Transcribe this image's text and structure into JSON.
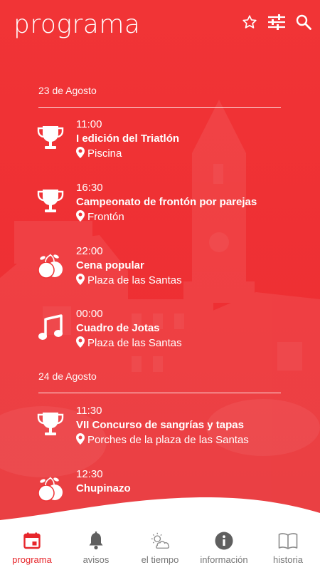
{
  "header": {
    "title": "programa",
    "icons": [
      "star-outline-icon",
      "sliders-icon",
      "search-icon"
    ]
  },
  "colors": {
    "brand_red": "#ef3235",
    "active_nav": "#e7262b",
    "inactive_nav": "#777777"
  },
  "days": [
    {
      "date": "23 de Agosto",
      "events": [
        {
          "time": "11:00",
          "name": "I edición del Triatlón",
          "place": "Piscina",
          "icon": "trophy-icon"
        },
        {
          "time": "16:30",
          "name": "Campeonato de frontón por parejas",
          "place": "Frontón",
          "icon": "trophy-icon"
        },
        {
          "time": "22:00",
          "name": "Cena popular",
          "place": "Plaza de las Santas",
          "icon": "food-icon"
        },
        {
          "time": "00:00",
          "name": "Cuadro de Jotas",
          "place": "Plaza de las Santas",
          "icon": "music-note-icon"
        }
      ]
    },
    {
      "date": "24 de Agosto",
      "events": [
        {
          "time": "11:30",
          "name": "VII Concurso de sangrías y tapas",
          "place": "Porches de la plaza de las Santas",
          "icon": "trophy-icon"
        },
        {
          "time": "12:30",
          "name": "Chupinazo",
          "place": "",
          "icon": "food-icon"
        }
      ]
    }
  ],
  "nav": [
    {
      "label": "programa",
      "icon": "calendar-icon",
      "active": true
    },
    {
      "label": "avisos",
      "icon": "bell-icon",
      "active": false
    },
    {
      "label": "el tiempo",
      "icon": "weather-icon",
      "active": false
    },
    {
      "label": "información",
      "icon": "info-icon",
      "active": false
    },
    {
      "label": "historia",
      "icon": "book-icon",
      "active": false
    }
  ]
}
